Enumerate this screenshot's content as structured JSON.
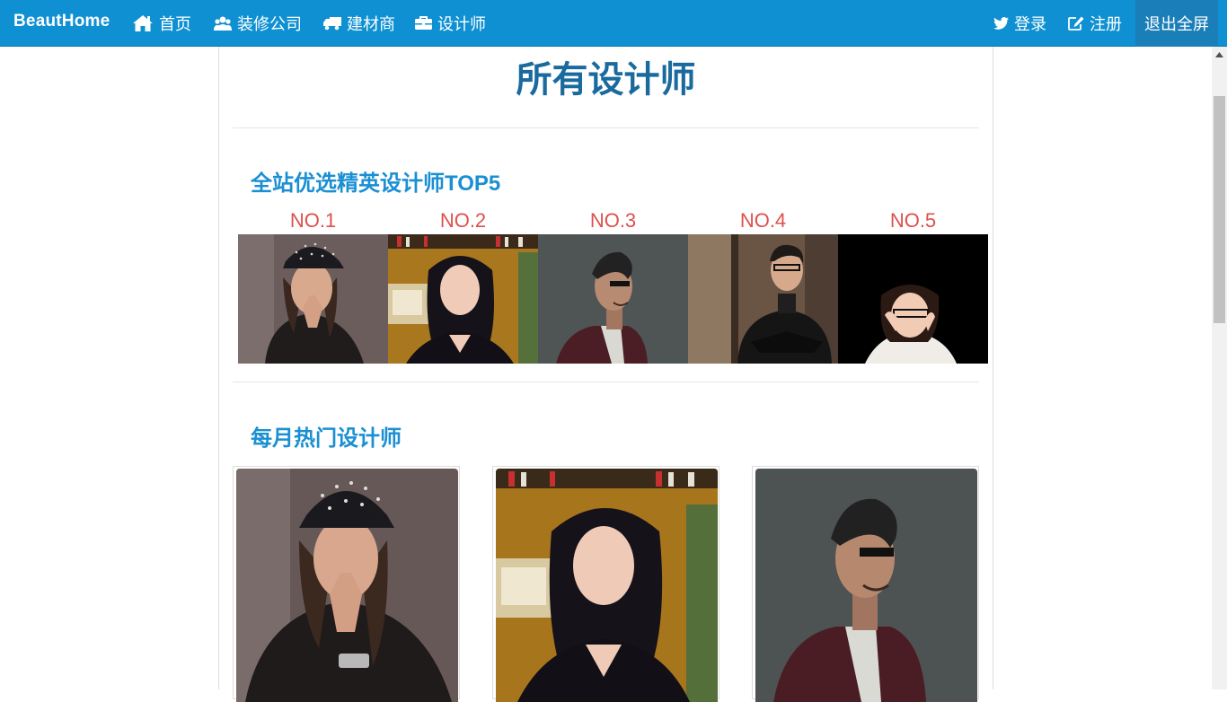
{
  "navbar": {
    "brand": "BeautHome",
    "items": [
      {
        "label": "首页",
        "icon": "home-icon"
      },
      {
        "label": "装修公司",
        "icon": "users-icon"
      },
      {
        "label": "建材商",
        "icon": "truck-icon"
      },
      {
        "label": "设计师",
        "icon": "briefcase-icon"
      }
    ],
    "login_label": "登录",
    "login_icon": "twitter-icon",
    "register_label": "注册",
    "register_icon": "edit-icon",
    "exit_fullscreen_label": "退出全屏"
  },
  "page": {
    "title": "所有设计师"
  },
  "top5": {
    "heading": "全站优选精英设计师TOP5",
    "ranks": [
      "NO.1",
      "NO.2",
      "NO.3",
      "NO.4",
      "NO.5"
    ]
  },
  "monthly": {
    "heading": "每月热门设计师"
  },
  "colors": {
    "navbar": "#0e90d2",
    "title": "#1a6a9e",
    "section_heading": "#1a8fd3",
    "rank": "#dd514c"
  }
}
